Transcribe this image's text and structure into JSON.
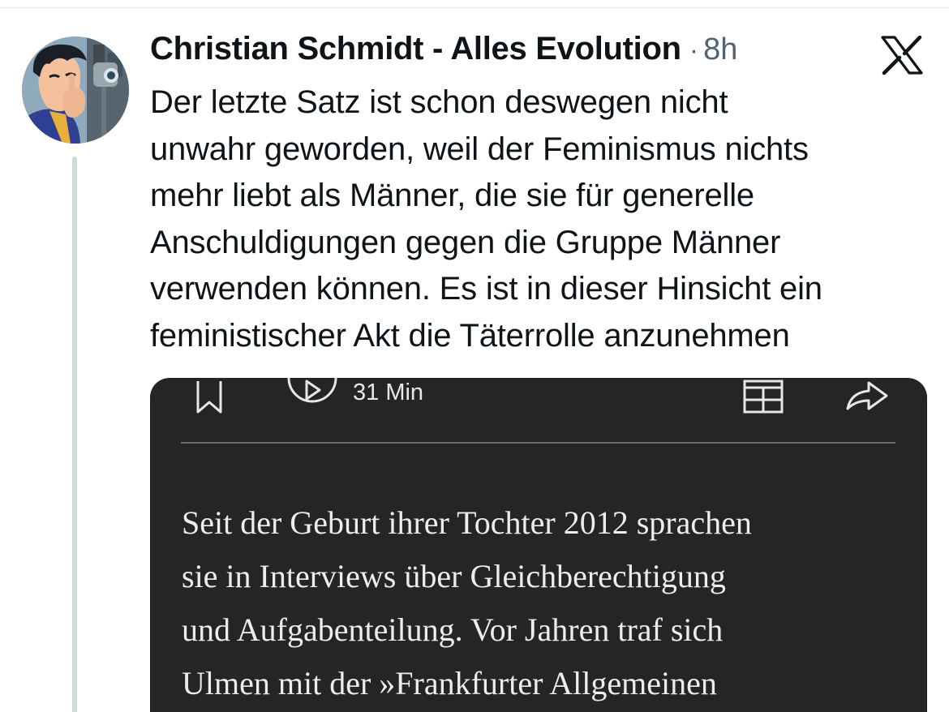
{
  "tweet": {
    "author_name": "Christian Schmidt - Alles Evolution",
    "separator": "·",
    "time": "8h",
    "text_lines": [
      "Der letzte Satz ist schon deswegen nicht",
      "unwahr geworden, weil der Feminismus nichts",
      "mehr liebt als Männer, die sie für generelle",
      "Anschuldigungen gegen die Gruppe Männer",
      "verwenden können. Es ist in dieser Hinsicht ein",
      "feministischer Akt die Täterrolle anzunehmen"
    ]
  },
  "media": {
    "duration_label": "31 Min",
    "article_lines": [
      "Seit der Geburt ihrer Tochter 2012 sprachen",
      "sie in Interviews über Gleichberechtigung",
      "und Aufgabenteilung. Vor Jahren traf sich",
      "Ulmen mit der »Frankfurter Allgemeinen"
    ]
  },
  "icons": {
    "platform_logo": "x-logo-icon",
    "bookmark": "bookmark-icon",
    "play": "play-icon",
    "layout": "grid-icon",
    "share": "share-icon"
  },
  "colors": {
    "text_primary": "#0f1419",
    "text_secondary": "#536471",
    "thread_line": "#cfd9de",
    "media_background": "#252525",
    "media_text": "#ededed"
  }
}
